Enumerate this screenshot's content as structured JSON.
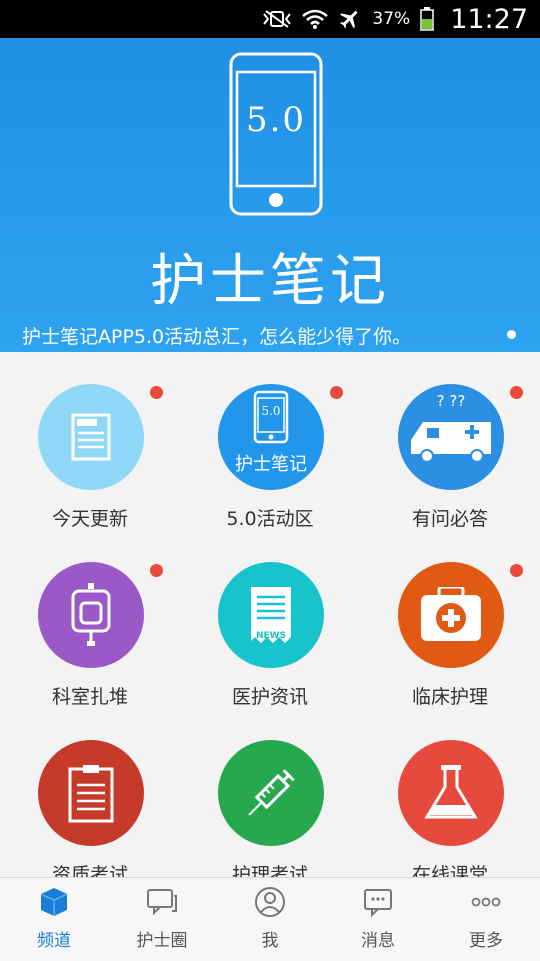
{
  "status_bar": {
    "battery_text": "37%",
    "time": "11:27",
    "icons": [
      "vibrate-off-icon",
      "wifi-icon",
      "airplane-icon",
      "battery-icon"
    ]
  },
  "banner": {
    "version": "5.0",
    "title": "护士笔记",
    "caption": "护士笔记APP5.0活动总汇，怎么能少得了你。",
    "color": "#2196ea"
  },
  "grid": {
    "items": [
      {
        "label": "今天更新",
        "icon": "news-icon",
        "color": "#8fd8f7",
        "badge": true
      },
      {
        "label": "5.0活动区",
        "icon": "phone-5-icon",
        "color": "#2196ea",
        "badge": true,
        "inner_version": "5.0",
        "inner_title": "护士笔记"
      },
      {
        "label": "有问必答",
        "icon": "ambulance-icon",
        "color": "#2b8fe3",
        "badge": true,
        "inner_marks": "? ??"
      },
      {
        "label": "科室扎堆",
        "icon": "iv-bag-icon",
        "color": "#9b59c7",
        "badge": true
      },
      {
        "label": "医护资讯",
        "icon": "news-receipt-icon",
        "color": "#19c3cc",
        "badge": false,
        "inner_news": "NEWS"
      },
      {
        "label": "临床护理",
        "icon": "first-aid-kit-icon",
        "color": "#e15a13",
        "badge": true
      },
      {
        "label": "资质考试",
        "icon": "clipboard-icon",
        "color": "#c63a2a",
        "badge": false
      },
      {
        "label": "护理考试",
        "icon": "syringe-icon",
        "color": "#27a84e",
        "badge": false
      },
      {
        "label": "在线课堂",
        "icon": "flask-icon",
        "color": "#e54a3d",
        "badge": false
      }
    ],
    "badge_color": "#e84b3b"
  },
  "bottom_nav": {
    "items": [
      {
        "label": "频道",
        "icon": "cube-icon",
        "active": true
      },
      {
        "label": "护士圈",
        "icon": "chat-bubbles-icon",
        "active": false
      },
      {
        "label": "我",
        "icon": "user-icon",
        "active": false
      },
      {
        "label": "消息",
        "icon": "message-icon",
        "active": false
      },
      {
        "label": "更多",
        "icon": "more-dots-icon",
        "active": false
      }
    ],
    "active_color": "#1a7ed8"
  }
}
